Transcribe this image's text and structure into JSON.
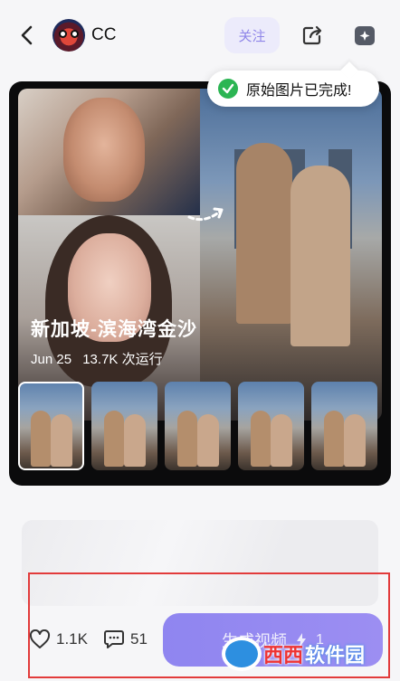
{
  "header": {
    "username": "CC",
    "follow_label": "关注"
  },
  "toast": {
    "message": "原始图片已完成!"
  },
  "card": {
    "title": "新加坡-滨海湾金沙",
    "date": "Jun 25",
    "runs": "13.7K 次运行",
    "thumbnail_count": 5
  },
  "actions": {
    "likes": "1.1K",
    "comments": "51",
    "generate_label": "生成视频",
    "generate_cost": "1"
  },
  "watermark": {
    "text_red": "西西",
    "text_white": "软件园"
  },
  "colors": {
    "accent": "#9b8ff2",
    "follow_bg": "#ecebfb",
    "success": "#2bb553",
    "highlight": "#e23b3b"
  }
}
